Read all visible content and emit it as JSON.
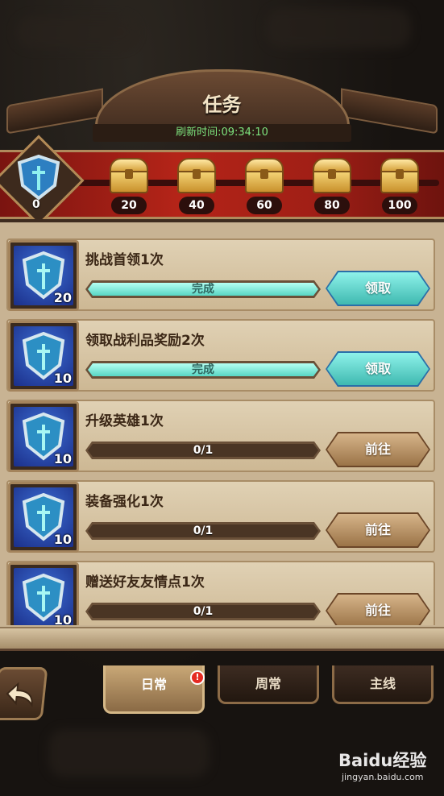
{
  "header": {
    "title": "任务",
    "refresh_text": "刷新时间:09:34:10"
  },
  "reward_bar": {
    "current_points": "0",
    "milestones": [
      {
        "label": "20"
      },
      {
        "label": "40"
      },
      {
        "label": "60"
      },
      {
        "label": "80"
      },
      {
        "label": "100"
      }
    ]
  },
  "tasks": [
    {
      "title": "挑战首领1次",
      "points": "20",
      "progress_text": "完成",
      "progress": 1.0,
      "button": "领取",
      "state": "claim"
    },
    {
      "title": "领取战利品奖励2次",
      "points": "10",
      "progress_text": "完成",
      "progress": 1.0,
      "button": "领取",
      "state": "claim"
    },
    {
      "title": "升级英雄1次",
      "points": "10",
      "progress_text": "0/1",
      "progress": 0.0,
      "button": "前往",
      "state": "go"
    },
    {
      "title": "装备强化1次",
      "points": "10",
      "progress_text": "0/1",
      "progress": 0.0,
      "button": "前往",
      "state": "go"
    },
    {
      "title": "赠送好友友情点1次",
      "points": "10",
      "progress_text": "0/1",
      "progress": 0.0,
      "button": "前往",
      "state": "go"
    }
  ],
  "tabs": {
    "daily": "日常",
    "weekly": "周常",
    "main": "主线",
    "daily_badge": "!"
  },
  "watermark": {
    "logo": "Baidu经验",
    "url": "jingyan.baidu.com"
  },
  "colors": {
    "claim_button": "#58d6c4",
    "go_button": "#b08a5c",
    "reward_bar": "#b42418",
    "refresh_text": "#7ee47e"
  }
}
